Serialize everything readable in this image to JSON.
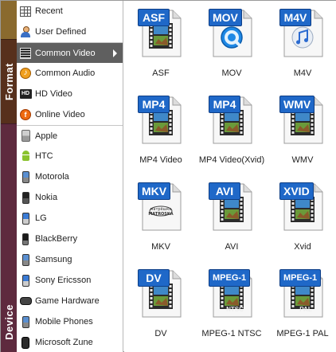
{
  "side_tabs": {
    "format": "Format",
    "device": "Device"
  },
  "menu": {
    "items": [
      {
        "label": "Recent",
        "icon": "recent-grid-icon"
      },
      {
        "label": "User Defined",
        "icon": "user-icon"
      },
      {
        "label": "Common Video",
        "icon": "film-icon",
        "selected": true
      },
      {
        "label": "Common Audio",
        "icon": "audio-note-icon"
      },
      {
        "label": "HD Video",
        "icon": "hd-icon"
      },
      {
        "label": "Online Video",
        "icon": "online-video-icon"
      },
      {
        "label": "Apple",
        "icon": "apple-device-icon"
      },
      {
        "label": "HTC",
        "icon": "android-icon"
      },
      {
        "label": "Motorola",
        "icon": "phone-icon"
      },
      {
        "label": "Nokia",
        "icon": "phone-icon"
      },
      {
        "label": "LG",
        "icon": "phone-icon"
      },
      {
        "label": "BlackBerry",
        "icon": "phone-icon"
      },
      {
        "label": "Samsung",
        "icon": "phone-icon"
      },
      {
        "label": "Sony Ericsson",
        "icon": "phone-icon"
      },
      {
        "label": "Game Hardware",
        "icon": "game-controller-icon"
      },
      {
        "label": "Mobile Phones",
        "icon": "phone-icon"
      },
      {
        "label": "Microsoft Zune",
        "icon": "zune-icon"
      }
    ]
  },
  "formats": [
    {
      "badge": "ASF",
      "caption": "ASF",
      "art": "film"
    },
    {
      "badge": "MOV",
      "caption": "MOV",
      "art": "quicktime"
    },
    {
      "badge": "M4V",
      "caption": "M4V",
      "art": "itunes"
    },
    {
      "badge": "MP4",
      "caption": "MP4 Video",
      "art": "film"
    },
    {
      "badge": "MP4",
      "caption": "MP4 Video(Xvid)",
      "art": "film"
    },
    {
      "badge": "WMV",
      "caption": "WMV",
      "art": "film"
    },
    {
      "badge": "MKV",
      "caption": "MKV",
      "art": "matroska"
    },
    {
      "badge": "AVI",
      "caption": "AVI",
      "art": "film"
    },
    {
      "badge": "XVID",
      "caption": "Xvid",
      "art": "film"
    },
    {
      "badge": "DV",
      "caption": "DV",
      "art": "film"
    },
    {
      "badge": "MPEG-1",
      "caption": "MPEG-1 NTSC",
      "art": "film",
      "sub": "NTSC"
    },
    {
      "badge": "MPEG-1",
      "caption": "MPEG-1 PAL",
      "art": "film",
      "sub": "PAL"
    }
  ],
  "colors": {
    "badge_blue": "#1f68c8",
    "selected_bg": "#5f5f5f",
    "format_tab": "#57301c",
    "device_tab": "#5e2a3e"
  }
}
